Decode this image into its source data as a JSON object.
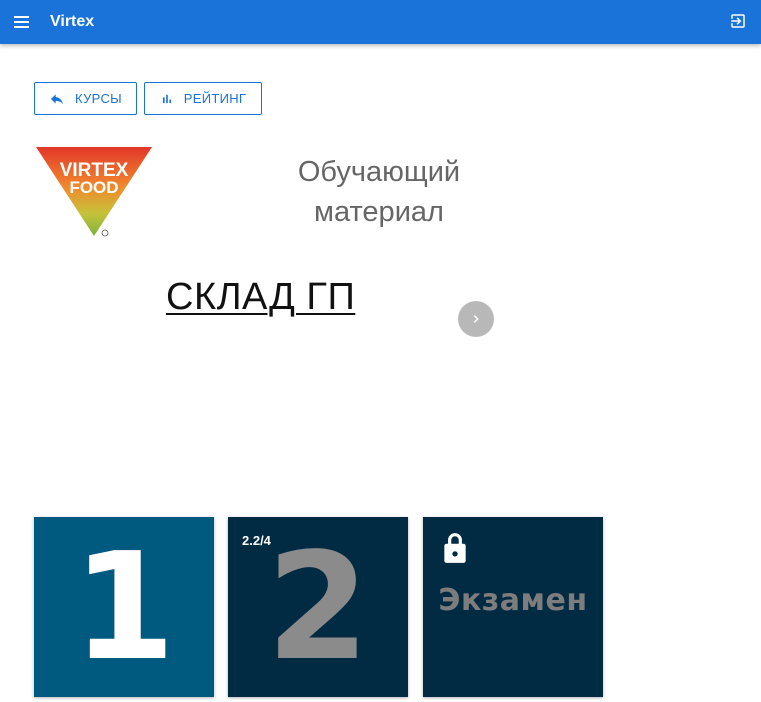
{
  "app": {
    "title": "Virtex"
  },
  "toolbar": {
    "menu_icon": "hamburger-menu-icon",
    "logout_icon": "logout-icon"
  },
  "nav": {
    "courses_label": "КУРСЫ",
    "courses_icon": "reply-arrow-icon",
    "rating_label": "РЕЙТИНГ",
    "rating_icon": "bar-chart-icon"
  },
  "slide": {
    "logo_text_line1": "VIRTEX",
    "logo_text_line2": "FOOD",
    "subtitle_line1": "Обучающий",
    "subtitle_line2": "материал",
    "title": "СКЛАД ГП",
    "next_icon": "chevron-right-icon"
  },
  "tiles": [
    {
      "number": "1",
      "progress": "",
      "locked": false
    },
    {
      "number": "2",
      "progress": "2.2/4",
      "locked": false
    },
    {
      "label": "Экзамен",
      "locked": true,
      "icon": "lock-icon"
    }
  ],
  "colors": {
    "primary": "#1a73d9",
    "tile_active": "#005a80",
    "tile_dark": "#002b42",
    "muted_number": "#8b8b8b"
  }
}
